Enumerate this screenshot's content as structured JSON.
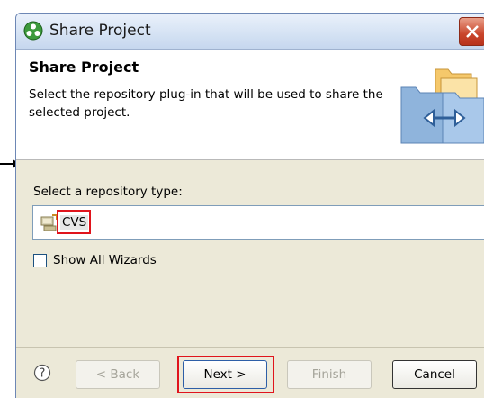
{
  "window": {
    "title": "Share Project"
  },
  "banner": {
    "title": "Share Project",
    "description": "Select the repository plug-in that will be used to share the selected project."
  },
  "repository": {
    "label": "Select a repository type:",
    "items": [
      {
        "label": "CVS",
        "icon": "cvs-repository-icon",
        "selected": true
      }
    ]
  },
  "options": {
    "show_all_wizards_label": "Show All Wizards",
    "show_all_wizards_checked": false
  },
  "buttons": {
    "help_icon": "help-icon",
    "back_label": "< Back",
    "next_label": "Next >",
    "finish_label": "Finish",
    "cancel_label": "Cancel"
  },
  "colors": {
    "highlight_box": "#e0141c",
    "title_bar": "#d6e3f4",
    "dialog_bg": "#ece9d8"
  }
}
